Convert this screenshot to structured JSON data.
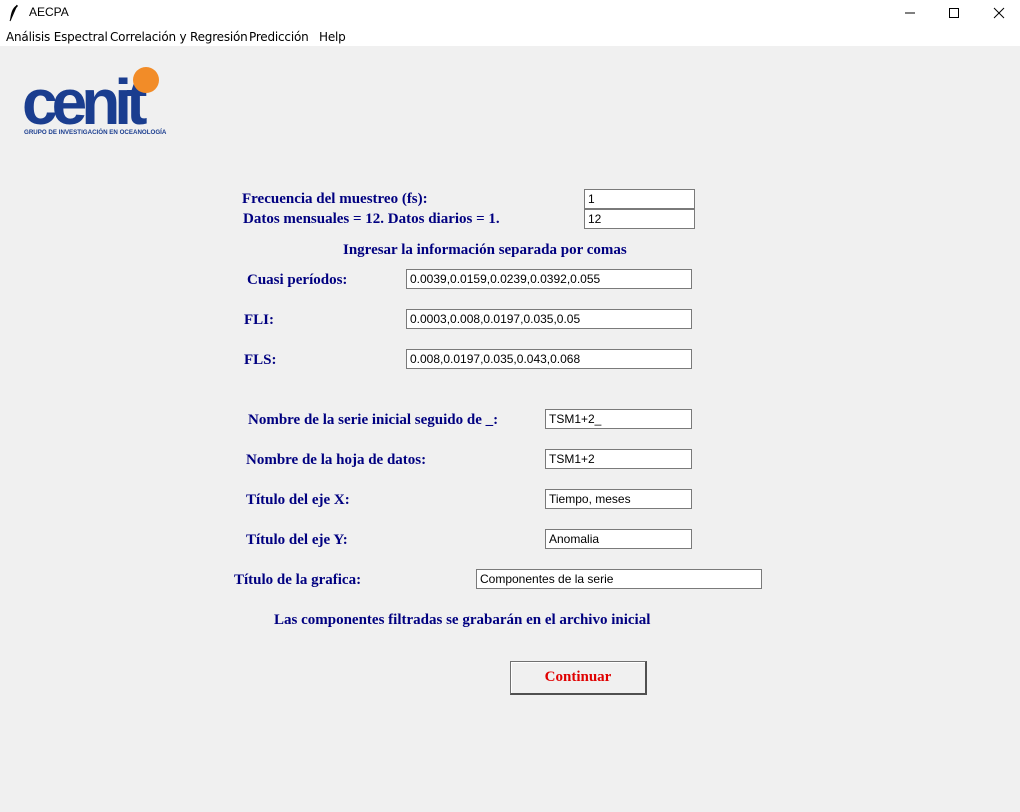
{
  "window": {
    "title": "AECPA",
    "icon": "feather-icon",
    "controls": [
      "minimize-icon",
      "maximize-icon",
      "close-icon"
    ]
  },
  "menu": {
    "items": [
      "Análisis Espectral",
      "Correlación y Regresión",
      "Predicción",
      "Help"
    ]
  },
  "logo": {
    "text": "cenit",
    "subtitle": "GRUPO DE INVESTIGACIÓN EN OCEANOLOGÍA",
    "colors": {
      "primary": "#1a3d8f",
      "dot": "#f28c28"
    }
  },
  "form": {
    "fs_label": "Frecuencia del muestreo (fs):",
    "fs_hint": "Datos mensuales = 12. Datos diarios = 1.",
    "fs_values": [
      "1",
      "12"
    ],
    "instruction": "Ingresar la información separada por comas",
    "cuasi_label": "Cuasi períodos:",
    "cuasi_value": "0.0039,0.0159,0.0239,0.0392,0.055",
    "fli_label": "FLI:",
    "fli_value": "0.0003,0.008,0.0197,0.035,0.05",
    "fls_label": "FLS:",
    "fls_value": "0.008,0.0197,0.035,0.043,0.068",
    "serie_label": "Nombre de la serie inicial seguido de _:",
    "serie_value": "TSM1+2_",
    "hoja_label": "Nombre de la hoja de datos:",
    "hoja_value": "TSM1+2",
    "ejex_label": "Título del eje X:",
    "ejex_value": "Tiempo, meses",
    "ejey_label": "Título del eje Y:",
    "ejey_value": "Anomalia",
    "grafica_label": "Título de la grafica:",
    "grafica_value": "Componentes de la serie",
    "note": "Las componentes filtradas se grabarán en el archivo inicial",
    "continue_label": "Continuar"
  },
  "colors": {
    "label_text": "#000080",
    "button_text": "#e00000",
    "background": "#f0f0f0"
  }
}
